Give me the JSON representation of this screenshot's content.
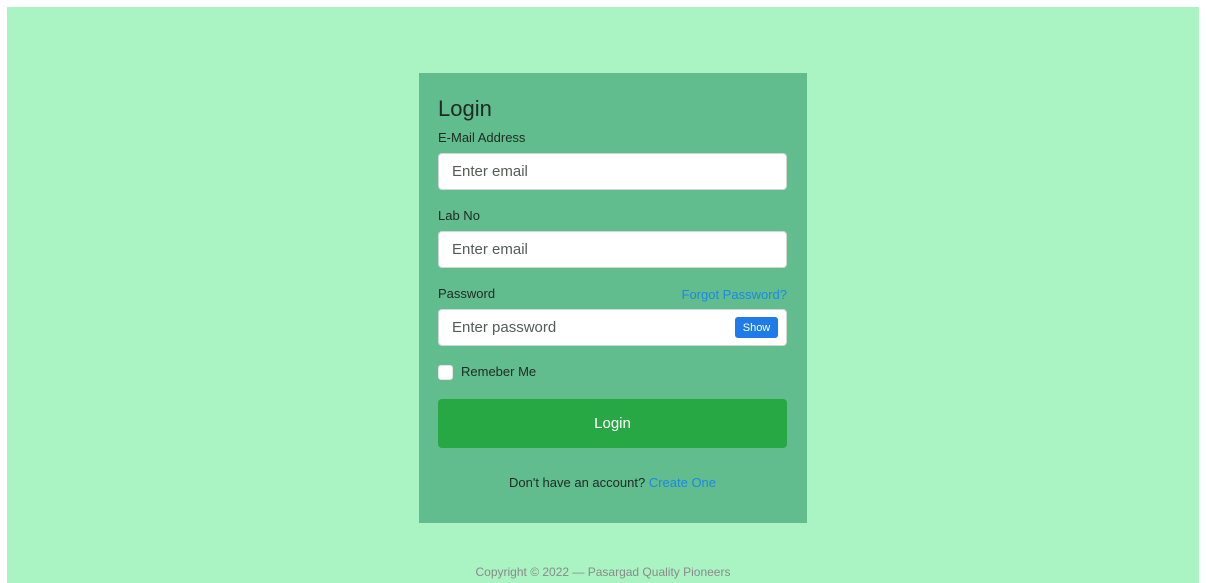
{
  "login": {
    "title": "Login",
    "email_label": "E-Mail Address",
    "email_placeholder": "Enter email",
    "lab_label": "Lab No",
    "lab_placeholder": "Enter email",
    "password_label": "Password",
    "forgot_link": "Forgot Password?",
    "password_placeholder": "Enter password",
    "show_button": "Show",
    "remember_label": "Remeber Me",
    "remember_checked": false,
    "submit_label": "Login",
    "signup_prompt": "Don't have an account?",
    "signup_link": "Create One"
  },
  "footer": {
    "copyright": "Copyright © 2022 — Pasargad Quality Pioneers"
  },
  "colors": {
    "page_background": "#a9f4c2",
    "card_background": "#61bc8e",
    "primary_button": "#28a745",
    "show_button": "#1f7be8",
    "link": "#1e88e5"
  }
}
